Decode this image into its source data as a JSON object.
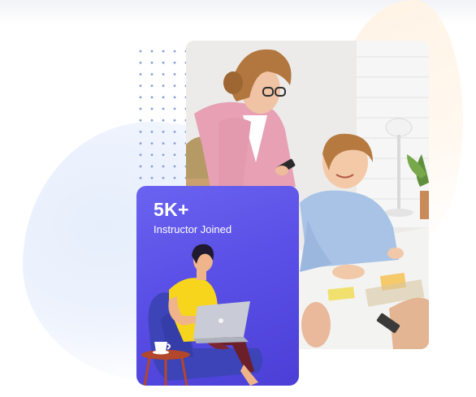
{
  "stat": {
    "value": "5K+",
    "label": "Instructor Joined"
  },
  "colors": {
    "card_gradient_start": "#6a63f0",
    "card_gradient_end": "#4b3fd6",
    "accent_yellow": "#f7d51d",
    "table_brown": "#b2472b"
  },
  "icons": [
    "dot-grid-decoration",
    "instructor-laptop-illustration",
    "coffee-cup-icon"
  ]
}
